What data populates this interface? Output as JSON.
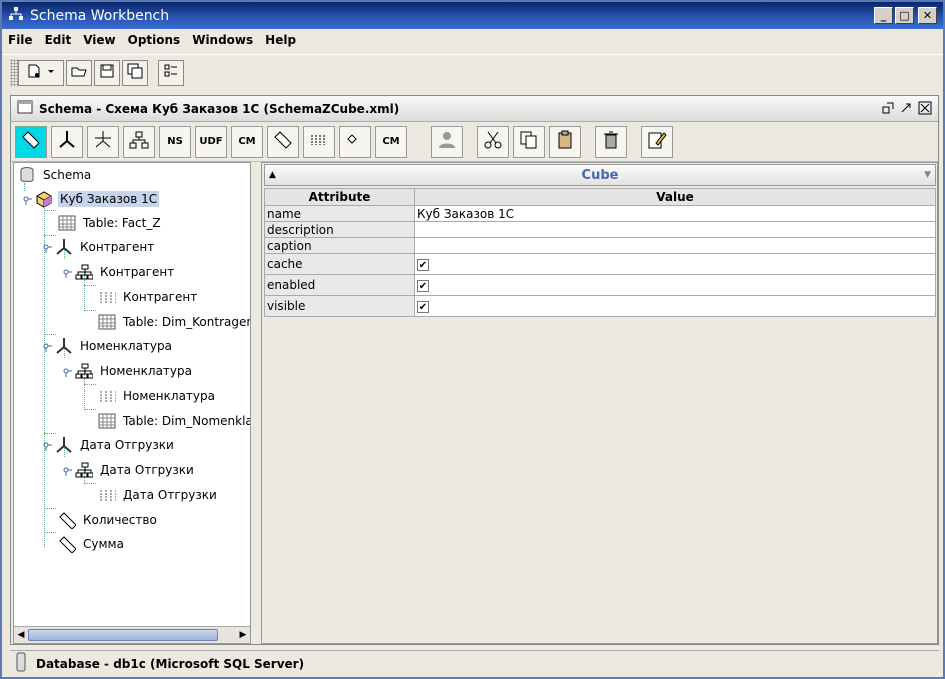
{
  "app": {
    "title": "Schema Workbench"
  },
  "menu": {
    "file": "File",
    "edit": "Edit",
    "view": "View",
    "options": "Options",
    "windows": "Windows",
    "help": "Help"
  },
  "schema_window": {
    "title": "Schema - Схема Куб Заказов 1С (SchemaZCube.xml)"
  },
  "toolbar2": {
    "ns": "NS",
    "udf": "UDF",
    "cm": "CM",
    "cm2": "CM"
  },
  "tree": {
    "schema": "Schema",
    "cube": "Куб Заказов 1С",
    "fact_table": "Table: Fact_Z",
    "dim1": "Контрагент",
    "dim1_hier": "Контрагент",
    "dim1_level": "Контрагент",
    "dim1_table": "Table: Dim_Kontragenty",
    "dim2": "Номенклатура",
    "dim2_hier": "Номенклатура",
    "dim2_level": "Номенклатура",
    "dim2_table": "Table: Dim_Nomenklatura",
    "dim3": "Дата Отгрузки",
    "dim3_hier": "Дата Отгрузки",
    "dim3_level": "Дата Отгрузки",
    "measure1": "Количество",
    "measure2": "Сумма"
  },
  "props": {
    "header": "Cube",
    "col_attr": "Attribute",
    "col_value": "Value",
    "rows": [
      {
        "attr": "name",
        "value": "Куб Заказов 1С"
      },
      {
        "attr": "description",
        "value": ""
      },
      {
        "attr": "caption",
        "value": ""
      },
      {
        "attr": "cache",
        "value": "✔"
      },
      {
        "attr": "enabled",
        "value": "✔"
      },
      {
        "attr": "visible",
        "value": "✔"
      }
    ]
  },
  "status": {
    "text": "Database - db1c (Microsoft SQL Server)"
  }
}
